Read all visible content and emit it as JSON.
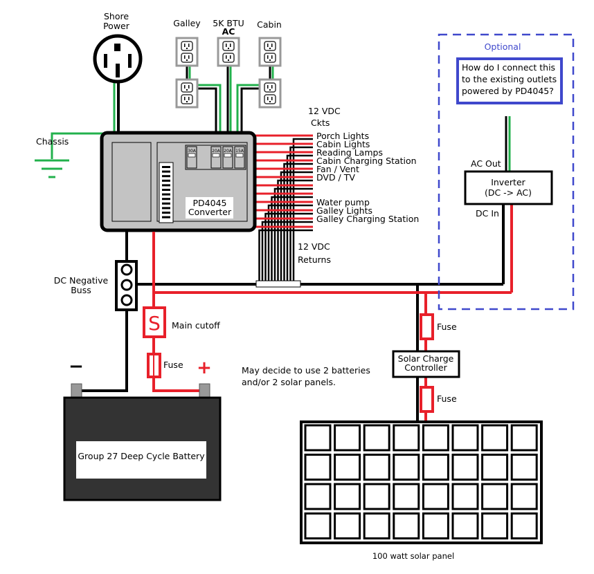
{
  "labels": {
    "shore_power": [
      "Shore",
      "Power"
    ],
    "galley": "Galley",
    "ac": [
      "5K BTU",
      "AC"
    ],
    "cabin": "Cabin",
    "chassis": "Chassis",
    "ckts": [
      "12 VDC",
      "Ckts"
    ],
    "returns": [
      "12 VDC",
      "Returns"
    ],
    "converter": [
      "PD4045",
      "Converter"
    ],
    "breakers": [
      "30A",
      "20A",
      "20A",
      "15A"
    ],
    "circuits": [
      "Porch  Lights",
      "Cabin  Lights",
      "Reading Lamps",
      "Cabin  Charging Station",
      "Fan / Vent",
      "DVD / TV",
      "",
      "",
      "Water pump",
      "Galley Lights",
      "Galley Charging Station"
    ],
    "dc_negative": [
      "DC Negative",
      "Buss"
    ],
    "main_cutoff_symbol": "S",
    "main_cutoff": "Main cutoff",
    "fuse": "Fuse",
    "minus": "−",
    "plus": "+",
    "note": [
      "May decide to use 2 batteries",
      "and/or 2 solar panels."
    ],
    "battery": "Group 27 Deep Cycle Battery",
    "solar_controller": [
      "Solar Charge",
      "Controller"
    ],
    "solar_panel": "100 watt solar panel",
    "optional": "Optional",
    "question": [
      "How do I connect this",
      "to the existing outlets",
      "powered by PD4045?"
    ],
    "ac_out": "AC Out",
    "inverter": [
      "Inverter",
      "(DC -> AC)"
    ],
    "dc_in": "DC In"
  },
  "colors": {
    "positive": "#e8202a",
    "negative": "#000000",
    "ground": "#22b14c",
    "optional": "#3f48cc",
    "converter": "#c3c3c3",
    "battery": "#333333"
  }
}
